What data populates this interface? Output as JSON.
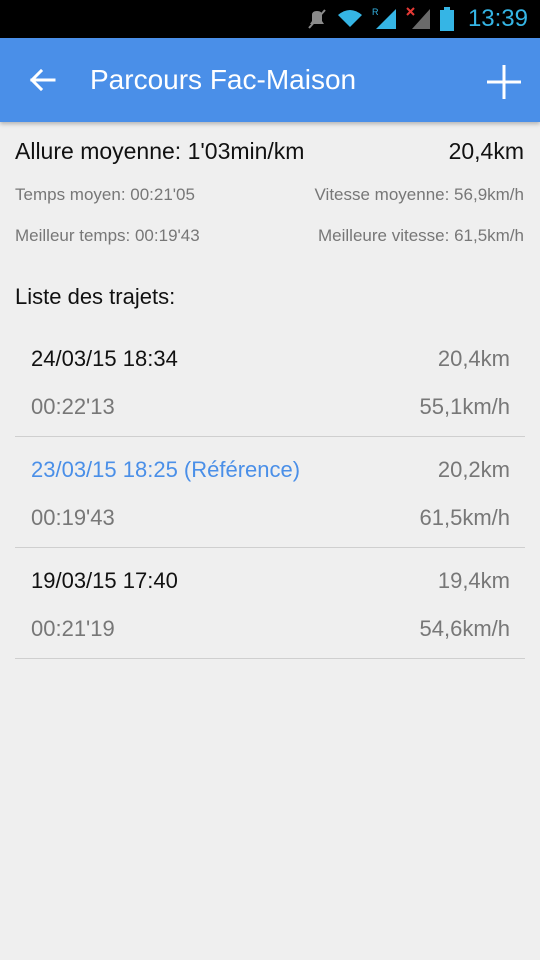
{
  "status_bar": {
    "time": "13:39",
    "icons": [
      "muted-icon",
      "wifi-icon",
      "signal-roaming-icon",
      "signal-no-service-icon",
      "battery-icon"
    ],
    "clock_color": "#35b5e5"
  },
  "app_bar": {
    "title": "Parcours Fac-Maison",
    "back_icon": "arrow-left-icon",
    "add_icon": "plus-icon",
    "color": "#4a8fe8"
  },
  "summary": {
    "pace_label": "Allure moyenne: 1'03min/km",
    "distance": "20,4km",
    "avg_time": "Temps moyen: 00:21'05",
    "avg_speed": "Vitesse moyenne: 56,9km/h",
    "best_time": "Meilleur temps: 00:19'43",
    "best_speed": "Meilleure vitesse: 61,5km/h"
  },
  "list": {
    "title": "Liste des trajets:",
    "reference_color": "#4a8fe8",
    "trips": [
      {
        "date": "24/03/15 18:34",
        "distance": "20,4km",
        "time": "00:22'13",
        "speed": "55,1km/h",
        "is_reference": false
      },
      {
        "date": "23/03/15 18:25 (Référence)",
        "distance": "20,2km",
        "time": "00:19'43",
        "speed": "61,5km/h",
        "is_reference": true
      },
      {
        "date": "19/03/15 17:40",
        "distance": "19,4km",
        "time": "00:21'19",
        "speed": "54,6km/h",
        "is_reference": false
      }
    ]
  }
}
